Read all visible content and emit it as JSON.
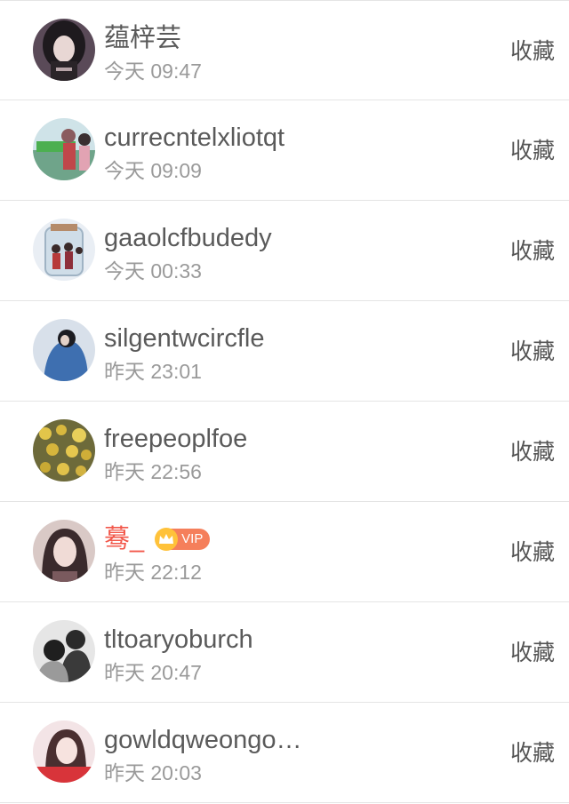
{
  "items": [
    {
      "name": "蕴梓芸",
      "time": "今天 09:47",
      "action": "收藏",
      "vip": false,
      "avatar": "avatar-girl-dark-hair"
    },
    {
      "name": "currecntelxliotqt",
      "time": "今天 09:09",
      "action": "收藏",
      "vip": false,
      "avatar": "avatar-group-photo"
    },
    {
      "name": "gaaolcfbudedy",
      "time": "今天 00:33",
      "action": "收藏",
      "vip": false,
      "avatar": "avatar-jar-figures"
    },
    {
      "name": "silgentwcircfle",
      "time": "昨天 23:01",
      "action": "收藏",
      "vip": false,
      "avatar": "avatar-blue-hoodie"
    },
    {
      "name": "freepeoplfoe",
      "time": "昨天 22:56",
      "action": "收藏",
      "vip": false,
      "avatar": "avatar-yellow-flowers"
    },
    {
      "name": "蓦_",
      "time": "昨天 22:12",
      "action": "收藏",
      "vip": true,
      "vip_label": "VIP",
      "avatar": "avatar-girl-portrait"
    },
    {
      "name": "tltoaryoburch",
      "time": "昨天 20:47",
      "action": "收藏",
      "vip": false,
      "avatar": "avatar-bw-couple"
    },
    {
      "name": "gowldqweongo…",
      "time": "昨天 20:03",
      "action": "收藏",
      "vip": false,
      "avatar": "avatar-red-girl"
    }
  ],
  "colors": {
    "vip_name": "#f2574a",
    "vip_badge": "#f57f5b",
    "crown": "#ffc23a",
    "name": "#5a5a5a",
    "time": "#9a9a9a",
    "divider": "#e4e4e4"
  }
}
